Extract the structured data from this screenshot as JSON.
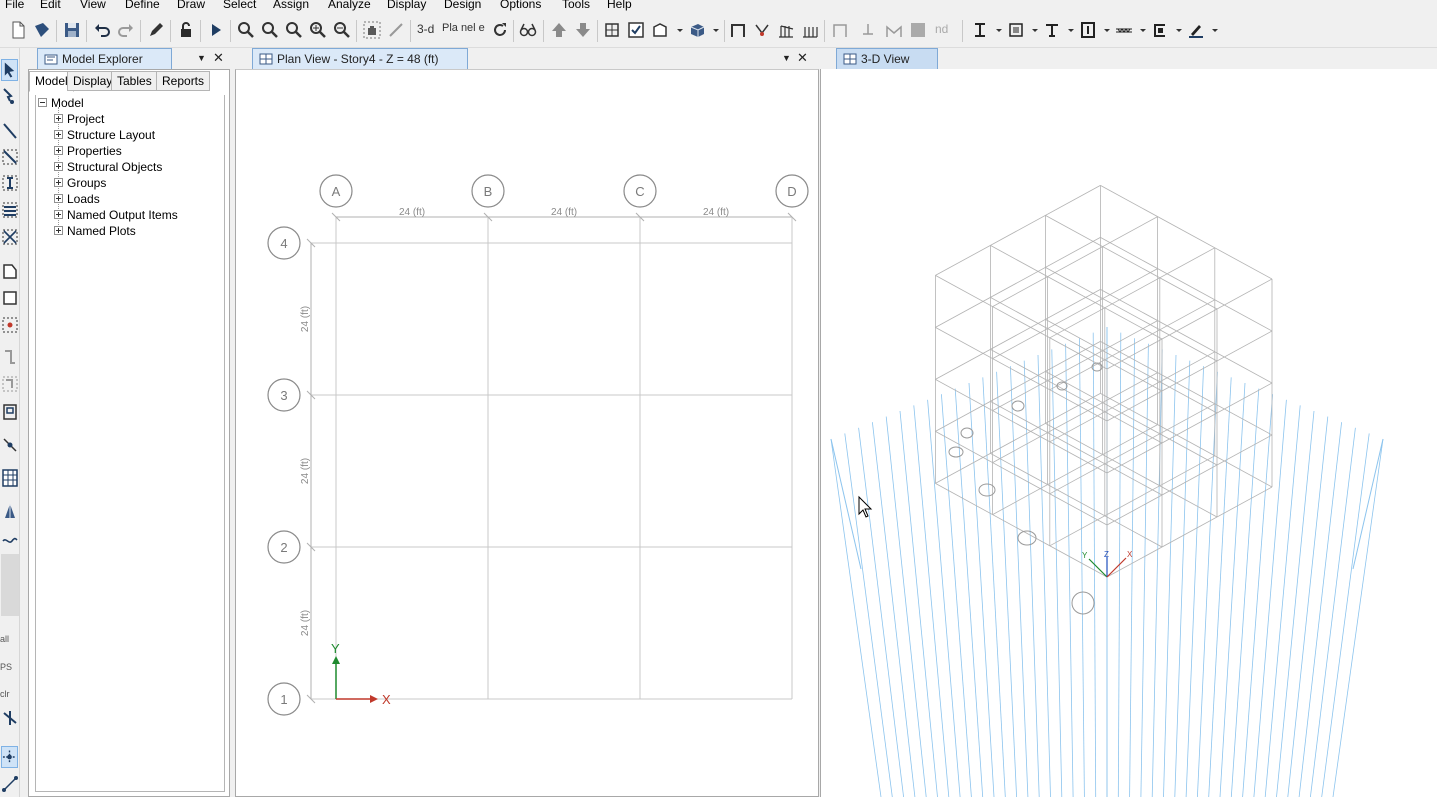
{
  "menu": [
    "File",
    "Edit",
    "View",
    "Define",
    "Draw",
    "Select",
    "Assign",
    "Analyze",
    "Display",
    "Design",
    "Options",
    "Tools",
    "Help"
  ],
  "toolbar": {
    "view_3d": "3-d",
    "view_plan": "Pla n",
    "view_elev": "el e",
    "label_nd": "nd"
  },
  "side_labels": {
    "all": "all",
    "ps": "PS",
    "clr": "clr"
  },
  "explorer": {
    "title": "Model Explorer",
    "tabs": [
      "Model",
      "Display",
      "Tables",
      "Reports"
    ],
    "root": "Model",
    "items": [
      "Project",
      "Structure Layout",
      "Properties",
      "Structural Objects",
      "Groups",
      "Loads",
      "Named Output Items",
      "Named Plots"
    ]
  },
  "plan_view": {
    "title": "Plan View - Story4 - Z = 48 (ft)",
    "grid_x": [
      "A",
      "B",
      "C",
      "D"
    ],
    "grid_y": [
      "1",
      "2",
      "3",
      "4"
    ],
    "spacing_x": [
      "24 (ft)",
      "24 (ft)",
      "24 (ft)"
    ],
    "spacing_y": [
      "24 (ft)",
      "24 (ft)",
      "24 (ft)"
    ],
    "axis_x": "X",
    "axis_y": "Y"
  },
  "view_3d": {
    "title": "3-D View",
    "axis_x": "X",
    "axis_y": "Y",
    "axis_z": "Z"
  },
  "colors": {
    "grid_line": "#c8c8c8",
    "bubble": "#8a8a8a",
    "axis_x": "#c0392b",
    "axis_y": "#1e8a2e",
    "axis_z": "#1f4fbf",
    "ground_grid": "#8cc4ee",
    "frame": "#b3b3b3"
  }
}
